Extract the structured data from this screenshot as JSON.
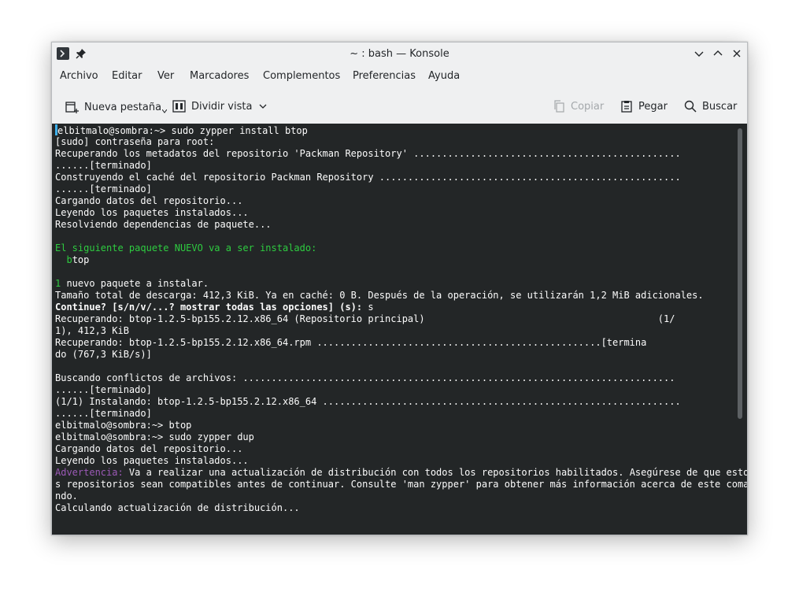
{
  "window": {
    "title": "~ : bash — Konsole"
  },
  "menubar": {
    "items": [
      "Archivo",
      "Editar",
      "Ver",
      "Marcadores",
      "Complementos",
      "Preferencias",
      "Ayuda"
    ]
  },
  "toolbar": {
    "new_tab": "Nueva pestaña",
    "split_view": "Dividir vista",
    "copy": "Copiar",
    "paste": "Pegar",
    "search": "Buscar"
  },
  "terminal": {
    "lines": [
      {
        "segments": [
          {
            "text": "elbitmalo@sombra:~> sudo zypper install btop"
          }
        ]
      },
      {
        "segments": [
          {
            "text": "[sudo] contraseña para root:"
          }
        ]
      },
      {
        "segments": [
          {
            "text": "Recuperando los metadatos del repositorio 'Packman Repository' ..............................................."
          }
        ]
      },
      {
        "segments": [
          {
            "text": "......[terminado]"
          }
        ]
      },
      {
        "segments": [
          {
            "text": "Construyendo el caché del repositorio Packman Repository ....................................................."
          }
        ]
      },
      {
        "segments": [
          {
            "text": "......[terminado]"
          }
        ]
      },
      {
        "segments": [
          {
            "text": "Cargando datos del repositorio..."
          }
        ]
      },
      {
        "segments": [
          {
            "text": "Leyendo los paquetes instalados..."
          }
        ]
      },
      {
        "segments": [
          {
            "text": "Resolviendo dependencias de paquete..."
          }
        ]
      },
      {
        "segments": [
          {
            "text": ""
          }
        ]
      },
      {
        "segments": [
          {
            "text": "El siguiente paquete NUEVO va a ser instalado:",
            "style": "green"
          }
        ]
      },
      {
        "segments": [
          {
            "text": "  "
          },
          {
            "text": "b",
            "style": "green"
          },
          {
            "text": "top"
          }
        ]
      },
      {
        "segments": [
          {
            "text": ""
          }
        ]
      },
      {
        "segments": [
          {
            "text": "1",
            "style": "green"
          },
          {
            "text": " nuevo paquete a instalar."
          }
        ]
      },
      {
        "segments": [
          {
            "text": "Tamaño total de descarga: 412,3 KiB. Ya en caché: 0 B. Después de la operación, se utilizarán 1,2 MiB adicionales."
          }
        ]
      },
      {
        "segments": [
          {
            "text": "Continue? [s/n/v/...? mostrar todas las opciones] (s):",
            "style": "bold"
          },
          {
            "text": " s"
          }
        ]
      },
      {
        "segments": [
          {
            "text": "Recuperando: btop-1.2.5-bp155.2.12.x86_64 (Repositorio principal)                                         (1/"
          }
        ]
      },
      {
        "segments": [
          {
            "text": "1), 412,3 KiB"
          }
        ]
      },
      {
        "segments": [
          {
            "text": "Recuperando: btop-1.2.5-bp155.2.12.x86_64.rpm ..................................................[termina"
          }
        ]
      },
      {
        "segments": [
          {
            "text": "do (767,3 KiB/s)]"
          }
        ]
      },
      {
        "segments": [
          {
            "text": ""
          }
        ]
      },
      {
        "segments": [
          {
            "text": "Buscando conflictos de archivos: ............................................................................"
          }
        ]
      },
      {
        "segments": [
          {
            "text": "......[terminado]"
          }
        ]
      },
      {
        "segments": [
          {
            "text": "(1/1) Instalando: btop-1.2.5-bp155.2.12.x86_64 ..............................................................."
          }
        ]
      },
      {
        "segments": [
          {
            "text": "......[terminado]"
          }
        ]
      },
      {
        "segments": [
          {
            "text": "elbitmalo@sombra:~> btop"
          }
        ]
      },
      {
        "segments": [
          {
            "text": "elbitmalo@sombra:~> sudo zypper dup"
          }
        ]
      },
      {
        "segments": [
          {
            "text": "Cargando datos del repositorio..."
          }
        ]
      },
      {
        "segments": [
          {
            "text": "Leyendo los paquetes instalados..."
          }
        ]
      },
      {
        "segments": [
          {
            "text": "Advertencia:",
            "style": "purple"
          },
          {
            "text": " Va a realizar una actualización de distribución con todos los repositorios habilitados. Asegúrese de que esto"
          }
        ]
      },
      {
        "segments": [
          {
            "text": "s repositorios sean compatibles antes de continuar. Consulte 'man zypper' para obtener más información acerca de este coma"
          }
        ]
      },
      {
        "segments": [
          {
            "text": "ndo."
          }
        ]
      },
      {
        "segments": [
          {
            "text": "Calculando actualización de distribución..."
          }
        ]
      }
    ]
  }
}
